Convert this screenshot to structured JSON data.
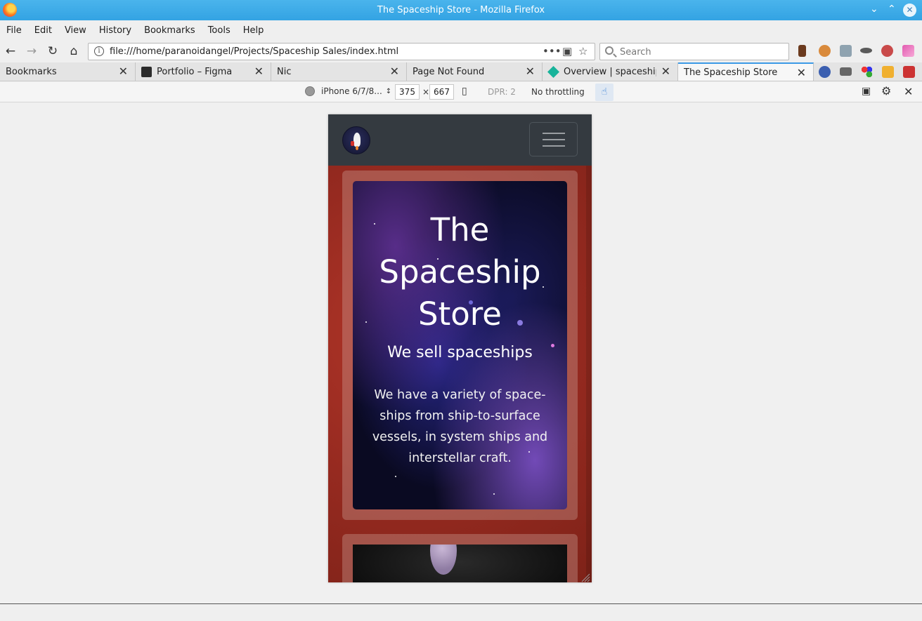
{
  "window": {
    "title": "The Spaceship Store - Mozilla Firefox"
  },
  "menu": [
    "File",
    "Edit",
    "View",
    "History",
    "Bookmarks",
    "Tools",
    "Help"
  ],
  "navbar": {
    "url": "file:///home/paranoidangel/Projects/Spaceship Sales/index.html",
    "search_placeholder": "Search"
  },
  "tabs": [
    {
      "label": "Bookmarks"
    },
    {
      "label": "Portfolio – Figma"
    },
    {
      "label": "Nic"
    },
    {
      "label": "Page Not Found"
    },
    {
      "label": "Overview | spaceship"
    },
    {
      "label": "The Spaceship Store",
      "active": true
    }
  ],
  "rdm": {
    "device": "iPhone 6/7/8...",
    "width": "375",
    "times": "×",
    "height": "667",
    "dpr": "DPR: 2",
    "throttling": "No throttling"
  },
  "site": {
    "hero_title": "The Spaceship Store",
    "hero_subtitle": "We sell spaceships",
    "hero_text": "We have a variety of space-ships from ship-to-surface vessels, in system ships and interstellar craft."
  },
  "colors": {
    "titlebar": "#33a3e3",
    "site_nav": "#343a40",
    "site_background": "#9b2a22",
    "tab_active_accent": "#3b99e6"
  },
  "icons": [
    "firefox-icon",
    "back-icon",
    "forward-icon",
    "reload-icon",
    "home-icon",
    "info-icon",
    "page-actions-icon",
    "pocket-icon",
    "bookmark-star-icon",
    "search-icon",
    "rocket-icon",
    "hamburger-icon",
    "screenshot-icon",
    "settings-icon",
    "close-icon"
  ]
}
